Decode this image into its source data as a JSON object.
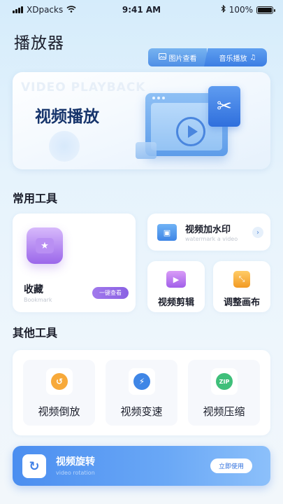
{
  "status_bar": {
    "carrier": "XDpacks",
    "time": "9:41 AM",
    "battery": "100%",
    "bluetooth_icon": "bluetooth-icon",
    "wifi_icon": "wifi-icon"
  },
  "header": {
    "title": "播放器"
  },
  "top_tabs": {
    "photo": "图片查看",
    "music": "音乐播放"
  },
  "hero": {
    "ghost_text": "VIDEO PLAYBACK",
    "title": "视频播放"
  },
  "common_tools": {
    "title": "常用工具",
    "favorites": {
      "label": "收藏",
      "sub": "Bookmark",
      "button": "一键查看"
    },
    "watermark": {
      "label": "视频加水印",
      "sub": "watermark a video"
    },
    "edit": {
      "label": "视频剪辑"
    },
    "adjust": {
      "label": "调整画布"
    }
  },
  "other_tools": {
    "title": "其他工具",
    "items": [
      {
        "label": "视频倒放",
        "icon": "rewind-icon"
      },
      {
        "label": "视频变速",
        "icon": "speed-icon"
      },
      {
        "label": "视频压缩",
        "icon": "zip-icon",
        "badge": "ZIP"
      }
    ]
  },
  "rotation": {
    "label": "视频旋转",
    "sub": "video rotation",
    "button": "立即使用"
  },
  "colors": {
    "accent": "#3f86e6",
    "purple": "#9b67ea"
  }
}
